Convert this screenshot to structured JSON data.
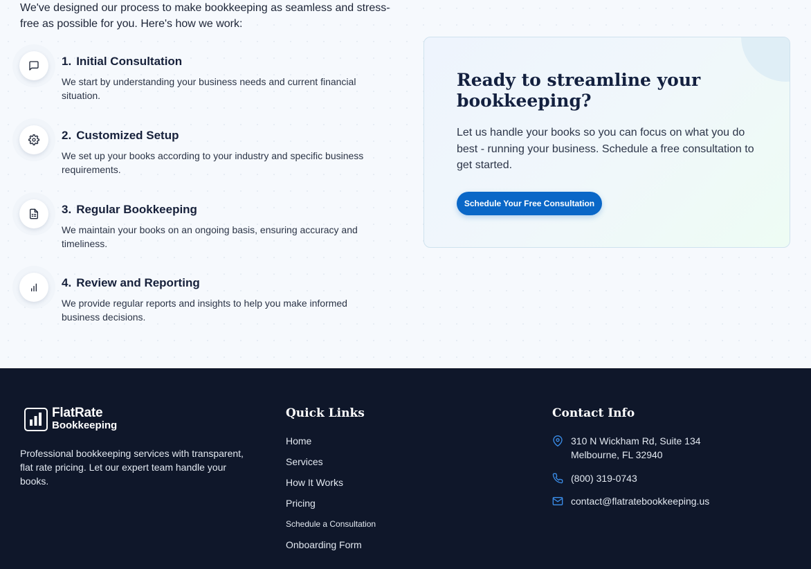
{
  "process": {
    "intro": "We've designed our process to make bookkeeping as seamless and stress-free as possible for you. Here's how we work:",
    "steps": [
      {
        "num": "1.",
        "title": "Initial Consultation",
        "desc": "We start by understanding your business needs and current financial situation.",
        "icon": "chat-icon"
      },
      {
        "num": "2.",
        "title": "Customized Setup",
        "desc": "We set up your books according to your industry and specific business requirements.",
        "icon": "gear-icon"
      },
      {
        "num": "3.",
        "title": "Regular Bookkeeping",
        "desc": "We maintain your books on an ongoing basis, ensuring accuracy and timeliness.",
        "icon": "document-icon"
      },
      {
        "num": "4.",
        "title": "Review and Reporting",
        "desc": "We provide regular reports and insights to help you make informed business decisions.",
        "icon": "bar-chart-icon"
      }
    ]
  },
  "cta": {
    "title": "Ready to streamline your bookkeeping?",
    "text": "Let us handle your books so you can focus on what you do best - running your business. Schedule a free consultation to get started.",
    "button": "Schedule Your Free Consultation"
  },
  "footer": {
    "logo_line1": "FlatRate",
    "logo_line2": "Bookkeeping",
    "description": "Professional bookkeeping services with transparent, flat rate pricing. Let our expert team handle your books.",
    "quick_links_title": "Quick Links",
    "quick_links": [
      "Home",
      "Services",
      "How It Works",
      "Pricing",
      "Schedule a Consultation",
      "Onboarding Form"
    ],
    "contact_title": "Contact Info",
    "address_line1": "310 N Wickham Rd, Suite 134",
    "address_line2": "Melbourne, FL 32940",
    "phone": "(800) 319-0743",
    "email": "contact@flatratebookkeeping.us"
  },
  "colors": {
    "accent": "#0a67c7",
    "footer_bg": "#0f172a",
    "heading": "#13203f"
  }
}
